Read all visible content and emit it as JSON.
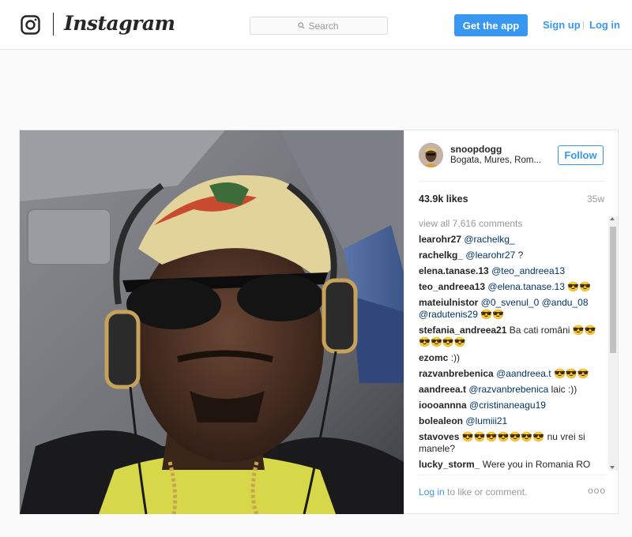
{
  "header": {
    "brand": "Instagram",
    "search_placeholder": "Search",
    "get_app_label": "Get the app",
    "signup_label": "Sign up",
    "separator": "|",
    "login_label": "Log in"
  },
  "post": {
    "username": "snoopdogg",
    "location": "Bogata, Mures, Rom...",
    "follow_label": "Follow",
    "likes": "43.9k likes",
    "age": "35w",
    "view_all": "view all 7,616 comments",
    "comments": [
      {
        "user": "learohr27",
        "mention": "@rachelkg_",
        "text": ""
      },
      {
        "user": "rachelkg_",
        "mention": "@learohr27",
        "text": " ?"
      },
      {
        "user": "elena.tanase.13",
        "mention": "@teo_andreea13",
        "text": ""
      },
      {
        "user": "teo_andreea13",
        "mention": "@elena.tanase.13",
        "text": " 😎😎"
      },
      {
        "user": "mateiulnistor",
        "mention": "@0_svenul_0 @andu_08 @radutenis29",
        "text": " 😎😎"
      },
      {
        "user": "stefania_andreea21",
        "mention": "",
        "text": " Ba cati români 😎😎 😎😎😎😎"
      },
      {
        "user": "ezomc",
        "mention": "",
        "text": " :))"
      },
      {
        "user": "razvanbrebenica",
        "mention": "@aandreea.t",
        "text": " 😎😎😎"
      },
      {
        "user": "aandreea.t",
        "mention": "@razvanbrebenica",
        "text": " laic :))"
      },
      {
        "user": "ioooannna",
        "mention": "@cristinaneagu19",
        "text": ""
      },
      {
        "user": "bolealeon",
        "mention": "@lumiii21",
        "text": ""
      },
      {
        "user": "stavoves",
        "mention": "",
        "text": " 😎😎😎😎😎😎😎 nu vrei si manele?"
      },
      {
        "user": "lucky_storm_",
        "mention": "",
        "text": " Were you in Romania RO"
      }
    ],
    "footer_login": "Log in",
    "footer_text": "to like or comment.",
    "more_label": "ooo"
  },
  "icons": {
    "logo": "instagram-camera-icon",
    "search": "search-icon",
    "more": "more-options-icon"
  },
  "colors": {
    "accent": "#3897f0",
    "text": "#262626",
    "muted": "#999999",
    "mention": "#003569"
  }
}
